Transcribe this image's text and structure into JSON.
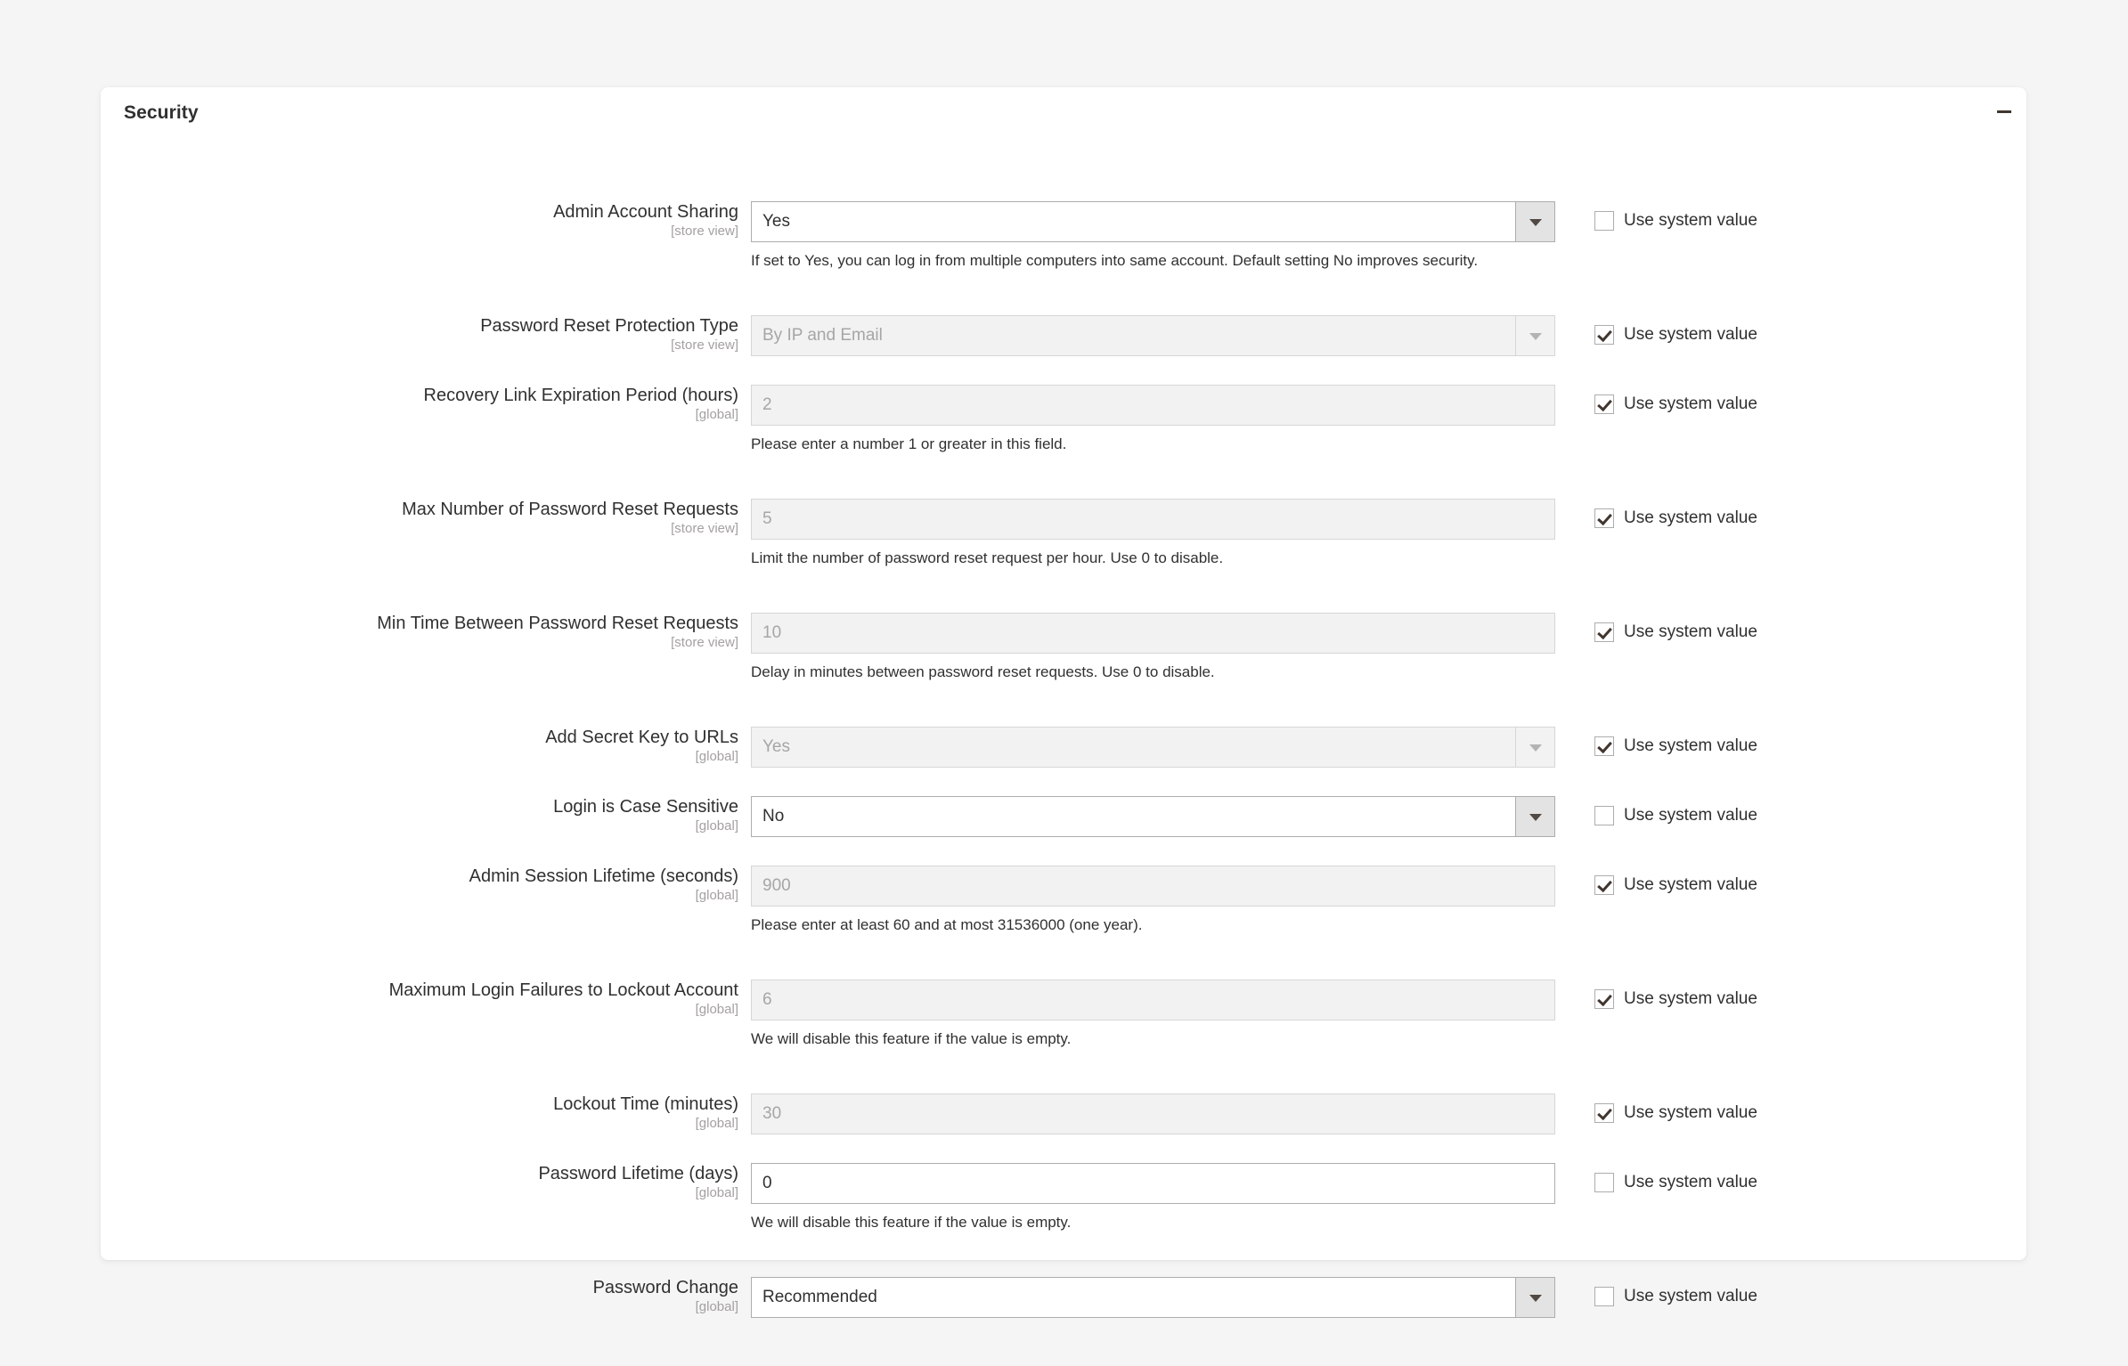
{
  "panel": {
    "title": "Security",
    "collapse_icon": "minus-icon"
  },
  "common": {
    "use_system_value_label": "Use system value",
    "scope_store_view": "[store view]",
    "scope_global": "[global]"
  },
  "fields": [
    {
      "id": "admin-account-sharing",
      "label": "Admin Account Sharing",
      "scope": "[store view]",
      "type": "select",
      "value": "Yes",
      "disabled": false,
      "use_system_value": false,
      "note": "If set to Yes, you can log in from multiple computers into same account. Default setting No improves security."
    },
    {
      "id": "password-reset-protection-type",
      "label": "Password Reset Protection Type",
      "scope": "[store view]",
      "type": "select",
      "value": "By IP and Email",
      "disabled": true,
      "use_system_value": true,
      "note": ""
    },
    {
      "id": "recovery-link-expiration-period",
      "label": "Recovery Link Expiration Period (hours)",
      "scope": "[global]",
      "type": "text",
      "value": "2",
      "disabled": true,
      "use_system_value": true,
      "note": "Please enter a number 1 or greater in this field."
    },
    {
      "id": "max-number-of-password-reset-requests",
      "label": "Max Number of Password Reset Requests",
      "scope": "[store view]",
      "type": "text",
      "value": "5",
      "disabled": true,
      "use_system_value": true,
      "note": "Limit the number of password reset request per hour. Use 0 to disable."
    },
    {
      "id": "min-time-between-password-reset-requests",
      "label": "Min Time Between Password Reset Requests",
      "scope": "[store view]",
      "type": "text",
      "value": "10",
      "disabled": true,
      "use_system_value": true,
      "note": "Delay in minutes between password reset requests. Use 0 to disable."
    },
    {
      "id": "add-secret-key-to-urls",
      "label": "Add Secret Key to URLs",
      "scope": "[global]",
      "type": "select",
      "value": "Yes",
      "disabled": true,
      "use_system_value": true,
      "note": ""
    },
    {
      "id": "login-is-case-sensitive",
      "label": "Login is Case Sensitive",
      "scope": "[global]",
      "type": "select",
      "value": "No",
      "disabled": false,
      "use_system_value": false,
      "note": ""
    },
    {
      "id": "admin-session-lifetime",
      "label": "Admin Session Lifetime (seconds)",
      "scope": "[global]",
      "type": "text",
      "value": "900",
      "disabled": true,
      "use_system_value": true,
      "note": "Please enter at least 60 and at most 31536000 (one year)."
    },
    {
      "id": "maximum-login-failures-to-lockout-account",
      "label": "Maximum Login Failures to Lockout Account",
      "scope": "[global]",
      "type": "text",
      "value": "6",
      "disabled": true,
      "use_system_value": true,
      "note": "We will disable this feature if the value is empty."
    },
    {
      "id": "lockout-time",
      "label": "Lockout Time (minutes)",
      "scope": "[global]",
      "type": "text",
      "value": "30",
      "disabled": true,
      "use_system_value": true,
      "note": ""
    },
    {
      "id": "password-lifetime",
      "label": "Password Lifetime (days)",
      "scope": "[global]",
      "type": "text",
      "value": "0",
      "disabled": false,
      "use_system_value": false,
      "note": "We will disable this feature if the value is empty."
    },
    {
      "id": "password-change",
      "label": "Password Change",
      "scope": "[global]",
      "type": "select",
      "value": "Recommended",
      "disabled": false,
      "use_system_value": false,
      "note": ""
    }
  ],
  "layout": {
    "row_tops": [
      205,
      283,
      335,
      414,
      492,
      570,
      648,
      674,
      752,
      830,
      882,
      960
    ]
  }
}
